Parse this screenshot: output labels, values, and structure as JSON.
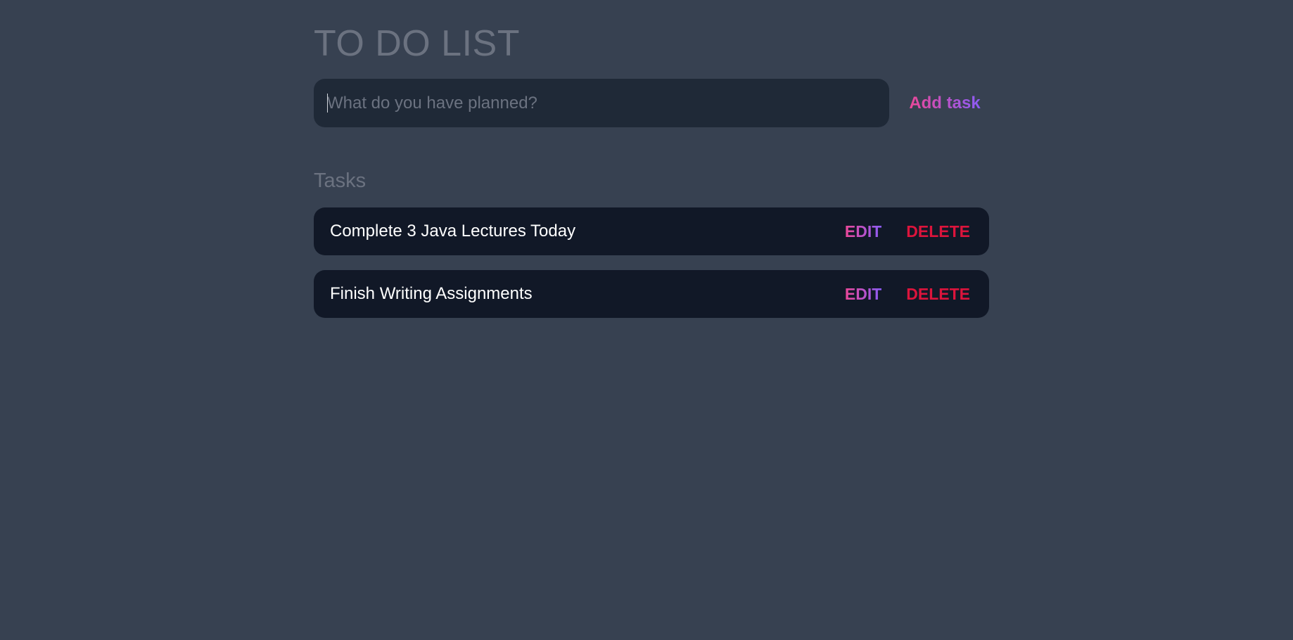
{
  "app": {
    "title": "TO DO LIST"
  },
  "form": {
    "input_value": "",
    "input_placeholder": "What do you have planned?",
    "add_label": "Add task"
  },
  "tasks": {
    "heading": "Tasks",
    "items": [
      {
        "text": "Complete 3 Java Lectures Today",
        "edit_label": "EDIT",
        "delete_label": "DELETE"
      },
      {
        "text": "Finish Writing Assignments",
        "edit_label": "EDIT",
        "delete_label": "DELETE"
      }
    ]
  },
  "colors": {
    "background": "#374151",
    "input_background": "#1f2937",
    "task_background": "#111827",
    "muted_text": "#6b7280",
    "accent_gradient_start": "#ec4899",
    "accent_gradient_end": "#8b5cf6",
    "delete": "#dc143c"
  }
}
